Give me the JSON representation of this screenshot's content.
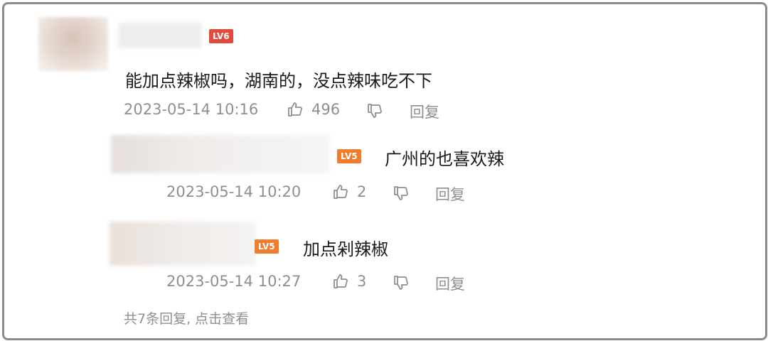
{
  "colors": {
    "badge_lv6": "#e34a3a",
    "badge_lv5": "#f07c2e",
    "text_main": "#1a1a1a",
    "text_meta": "#8f8f8f",
    "frame_border": "#8c8c8c"
  },
  "comment": {
    "level_badge": "LV6",
    "text": "能加点辣椒吗，湖南的，没点辣味吃不下",
    "time": "2023-05-14 10:16",
    "likes": "496",
    "reply_label": "回复",
    "icons": {
      "like": "thumbs-up-icon",
      "dislike": "thumbs-down-icon"
    }
  },
  "replies": [
    {
      "level_badge": "LV5",
      "text": "广州的也喜欢辣",
      "time": "2023-05-14 10:20",
      "likes": "2",
      "reply_label": "回复"
    },
    {
      "level_badge": "LV5",
      "text": "加点剁辣椒",
      "time": "2023-05-14 10:27",
      "likes": "3",
      "reply_label": "回复"
    }
  ],
  "more_replies": "共7条回复, 点击查看"
}
